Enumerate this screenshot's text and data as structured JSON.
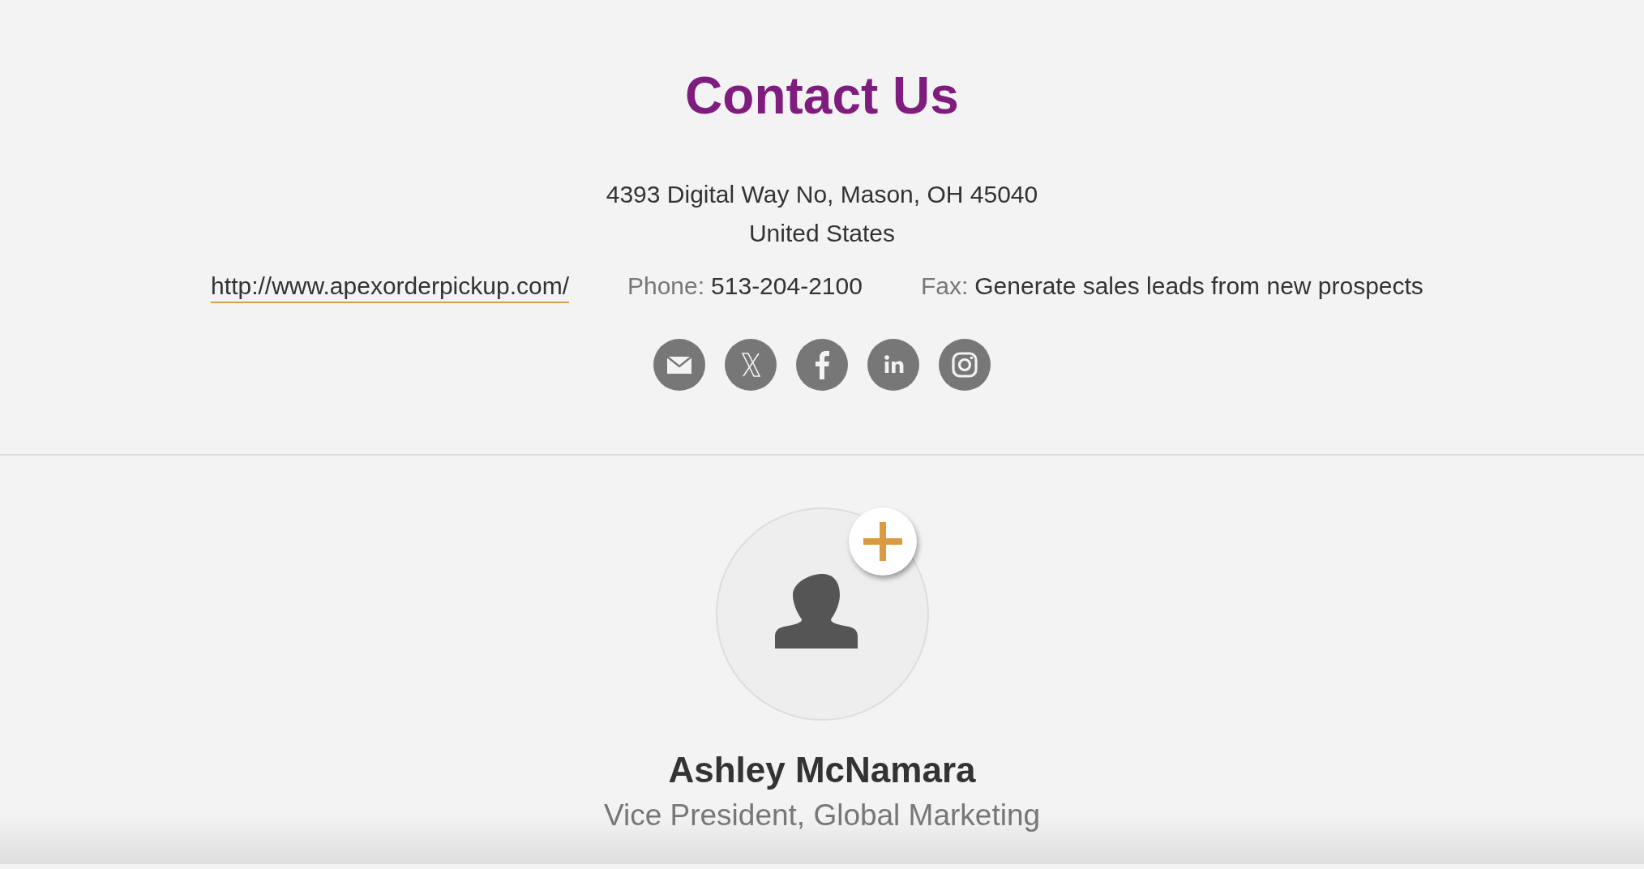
{
  "title": "Contact Us",
  "address": [
    "4393 Digital Way No, Mason, OH  45040",
    "United States"
  ],
  "website": "http://www.apexorderpickup.com/",
  "phone": {
    "label": "Phone:",
    "value": "513-204-2100"
  },
  "fax": {
    "label": "Fax:",
    "value": "Generate sales leads from new prospects"
  },
  "person": {
    "name": "Ashley McNamara",
    "role": "Vice President, Global Marketing"
  }
}
